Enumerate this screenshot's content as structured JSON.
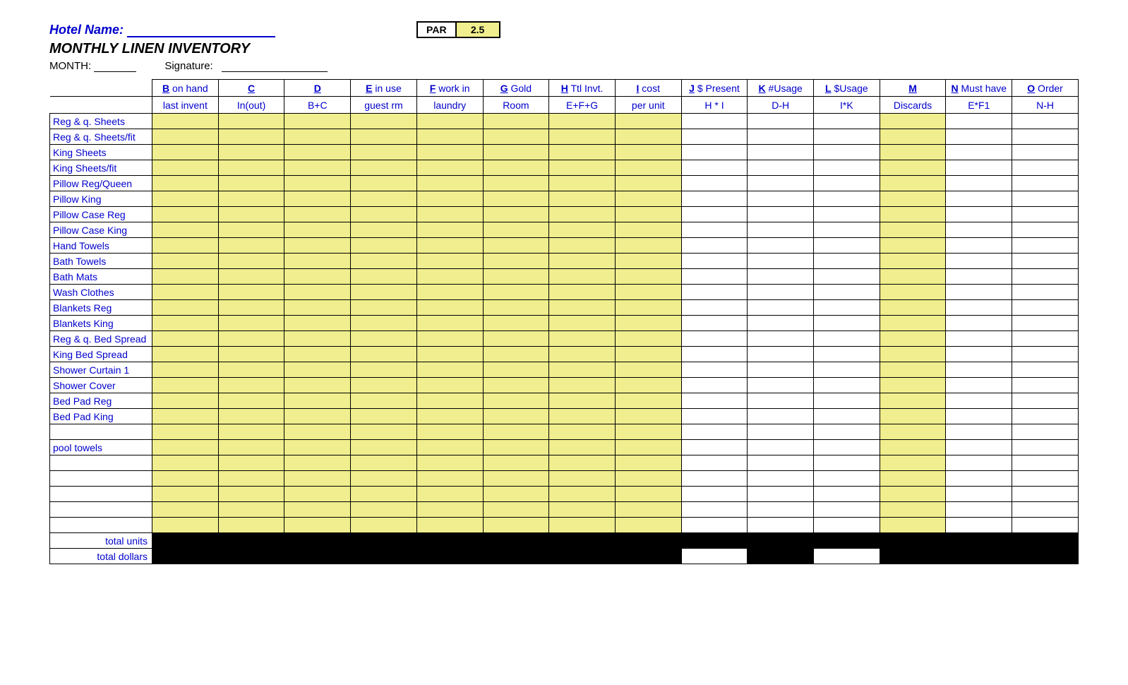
{
  "header": {
    "hotel_name_label": "Hotel Name:",
    "par_label": "PAR",
    "par_value": "2.5",
    "title": "MONTHLY LINEN INVENTORY",
    "month_label": "MONTH:",
    "signature_label": "Signature:"
  },
  "columns": [
    {
      "letter": "",
      "line1": "",
      "line2": ""
    },
    {
      "letter": "B",
      "line1": " on hand",
      "line2": "last invent"
    },
    {
      "letter": "C",
      "line1": "",
      "line2": "In(out)"
    },
    {
      "letter": "D",
      "line1": "",
      "line2": "B+C"
    },
    {
      "letter": "E",
      "line1": " in use",
      "line2": "guest rm"
    },
    {
      "letter": "F",
      "line1": " work in",
      "line2": "laundry"
    },
    {
      "letter": "G",
      "line1": " Gold",
      "line2": "Room"
    },
    {
      "letter": "H",
      "line1": " Ttl Invt.",
      "line2": "E+F+G"
    },
    {
      "letter": "I",
      "line1": " cost",
      "line2": "per unit"
    },
    {
      "letter": "J",
      "line1": " $ Present",
      "line2": "H * I"
    },
    {
      "letter": "K",
      "line1": " #Usage",
      "line2": "D-H"
    },
    {
      "letter": "L",
      "line1": " $Usage",
      "line2": "I*K"
    },
    {
      "letter": "M",
      "line1": "",
      "line2": "Discards"
    },
    {
      "letter": "N",
      "line1": " Must have",
      "line2": "E*F1"
    },
    {
      "letter": "O",
      "line1": " Order",
      "line2": "N-H"
    }
  ],
  "yellow_columns": [
    1,
    2,
    3,
    4,
    5,
    6,
    7,
    8,
    12
  ],
  "items": [
    "Reg & q. Sheets",
    "Reg & q.  Sheets/fit",
    "King Sheets",
    "King Sheets/fit",
    "Pillow Reg/Queen",
    "Pillow King",
    "Pillow Case Reg",
    "Pillow Case King",
    "Hand Towels",
    "Bath Towels",
    "Bath Mats",
    "Wash Clothes",
    "Blankets Reg",
    "Blankets King",
    "Reg & q. Bed Spread",
    "King Bed Spread",
    "Shower Curtain 1",
    "Shower Cover",
    "Bed Pad  Reg",
    "Bed Pad King",
    "",
    "pool towels",
    "",
    "",
    "",
    "",
    ""
  ],
  "totals": {
    "units_label": "total units",
    "dollars_label": "total dollars"
  }
}
